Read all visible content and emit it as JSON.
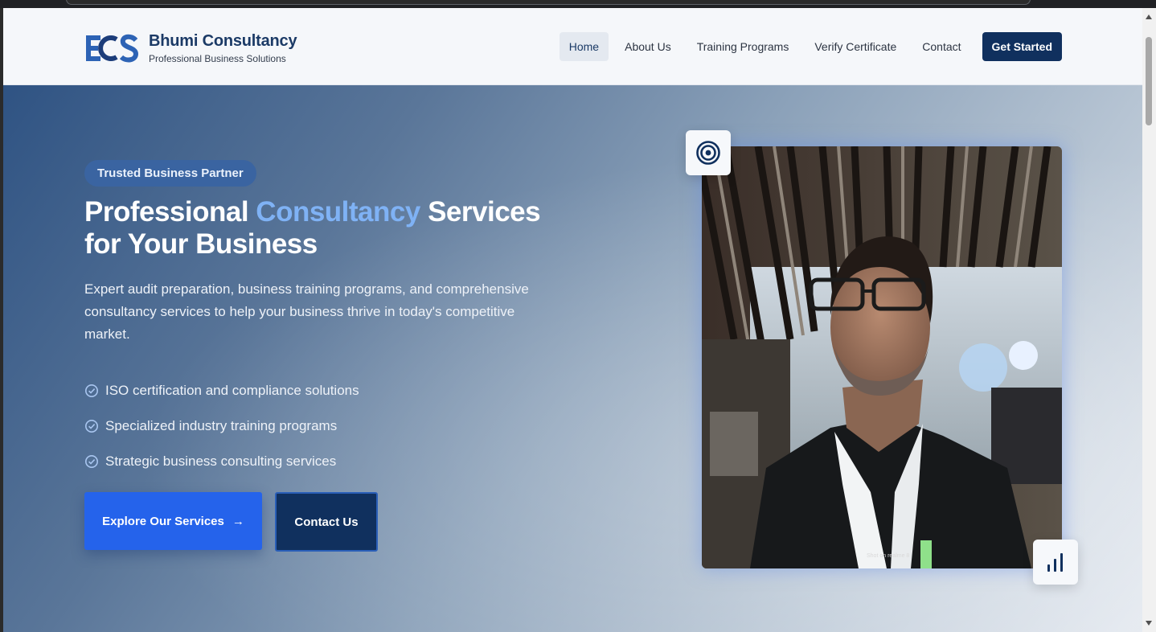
{
  "brand": {
    "logo_text": "ECS",
    "name": "Bhumi Consultancy",
    "tagline": "Professional Business Solutions"
  },
  "nav": {
    "items": [
      {
        "label": "Home",
        "active": true
      },
      {
        "label": "About Us",
        "active": false
      },
      {
        "label": "Training Programs",
        "active": false
      },
      {
        "label": "Verify Certificate",
        "active": false
      },
      {
        "label": "Contact",
        "active": false
      }
    ],
    "cta_label": "Get Started"
  },
  "hero": {
    "badge": "Trusted Business Partner",
    "title_part1": "Professional ",
    "title_accent": "Consultancy",
    "title_part2": " Services for Your Business",
    "lead": "Expert audit preparation, business training programs, and comprehensive consultancy services to help your business thrive in today's competitive market.",
    "features": [
      "ISO certification and compliance solutions",
      "Specialized industry training programs",
      "Strategic business consulting services"
    ],
    "primary_button": "Explore Our Services",
    "secondary_button": "Contact Us",
    "photo_watermark": "Shot on realme 8"
  },
  "icons": {
    "target": "target-icon",
    "chart": "bar-chart-icon",
    "check": "check-circle-icon",
    "arrow": "arrow-right-icon"
  },
  "colors": {
    "brand_navy": "#10305e",
    "accent_blue": "#2563eb",
    "accent_light": "#7fb2f5"
  }
}
